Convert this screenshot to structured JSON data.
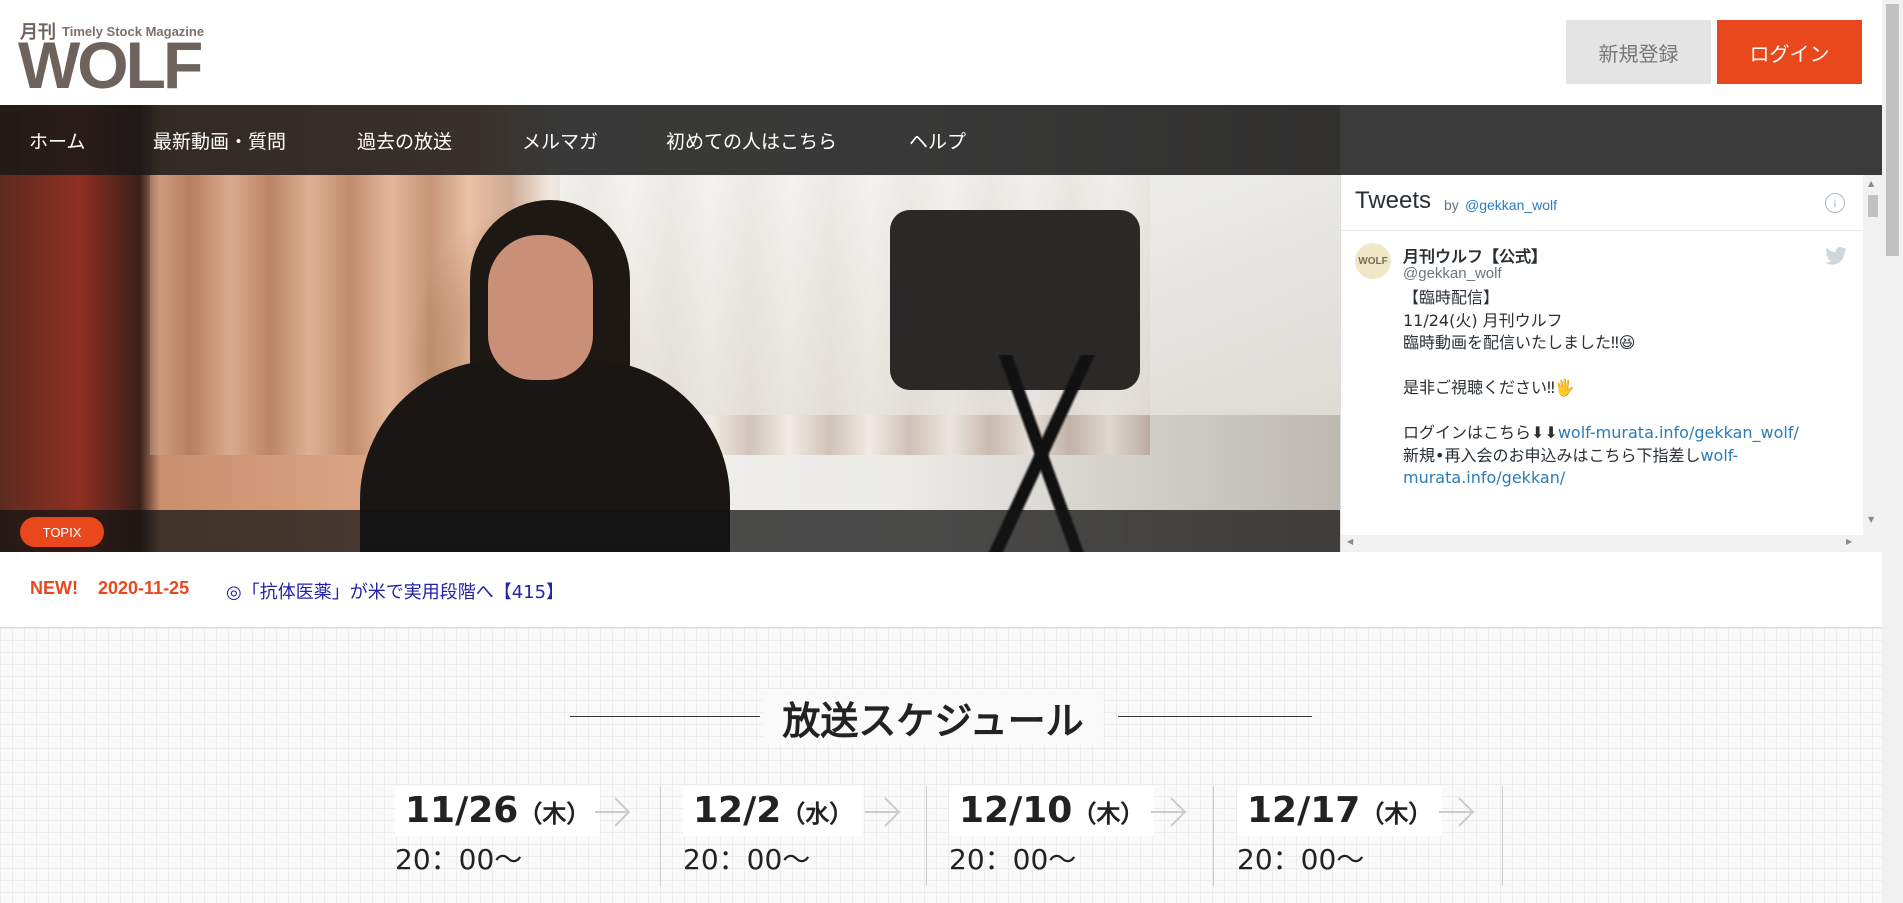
{
  "header": {
    "logo_kanji": "月刊",
    "logo_tagline": "Timely Stock Magazine",
    "logo_wordmark": "WOLF",
    "register_label": "新規登録",
    "login_label": "ログイン"
  },
  "nav": {
    "items": [
      {
        "label": "ホーム"
      },
      {
        "label": "最新動画・質問"
      },
      {
        "label": "過去の放送"
      },
      {
        "label": "メルマガ"
      },
      {
        "label": "初めての人はこちら"
      },
      {
        "label": "ヘルプ"
      }
    ]
  },
  "hero": {
    "badge": "TOPIX"
  },
  "tweets": {
    "title": "Tweets",
    "by": "by",
    "handle": "@gekkan_wolf",
    "info_glyph": "i",
    "tweet": {
      "avatar_text": "WOLF",
      "name": "月刊ウルフ【公式】",
      "username": "@gekkan_wolf",
      "lines": [
        "【臨時配信】",
        "11/24(火)  月刊ウルフ",
        "臨時動画を配信いたしました‼😆",
        "",
        "是非ご視聴ください‼🖐",
        "",
        "ログインはこちら⬇⬇",
        "新規•再入会のお申込みはこちら下指差し"
      ],
      "link_login": "wolf-murata.info/gekkan_wolf/",
      "link_signup_a": "wolf-",
      "link_signup_b": "murata.info/gekkan/"
    }
  },
  "news": {
    "new_label": "NEW!",
    "date": "2020-11-25",
    "title": "◎「抗体医薬」が米で実用段階へ【415】"
  },
  "schedule": {
    "title": "放送スケジュール",
    "entries": [
      {
        "date": "11/26",
        "dow": "（木）",
        "time": "20：00〜"
      },
      {
        "date": "12/2",
        "dow": "（水）",
        "time": "20：00〜"
      },
      {
        "date": "12/10",
        "dow": "（木）",
        "time": "20：00〜"
      },
      {
        "date": "12/17",
        "dow": "（木）",
        "time": "20：00〜"
      }
    ]
  },
  "colors": {
    "accent": "#e8481c",
    "nav_bg": "#191919",
    "twitter_link": "#2b7bb9",
    "news_link": "#2222aa"
  },
  "icons": [
    "info-icon",
    "twitter-bird-icon",
    "arrow-right-icon"
  ]
}
